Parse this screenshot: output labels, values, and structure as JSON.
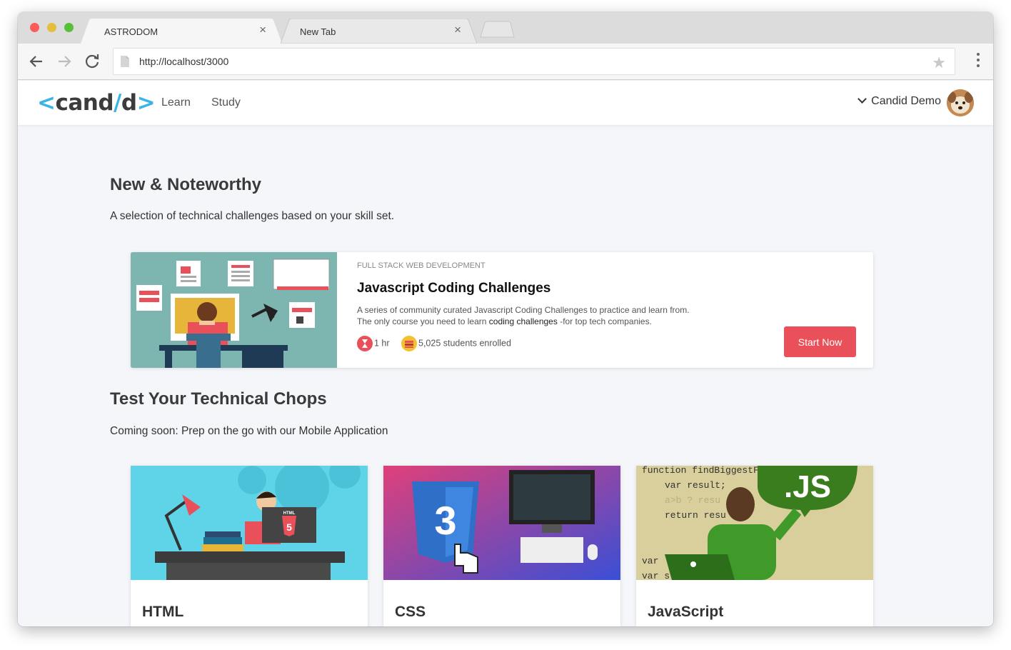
{
  "browser": {
    "tabs": [
      {
        "title": "ASTRODOM",
        "active": true
      },
      {
        "title": "New Tab",
        "active": false
      }
    ],
    "url": "http://localhost/3000"
  },
  "header": {
    "logo": {
      "left": "<",
      "text_a": "cand",
      "slash": "/",
      "text_b": "d",
      "right": ">"
    },
    "nav": [
      "Learn",
      "Study"
    ],
    "user_name": "Candid Demo"
  },
  "section1": {
    "title": "New & Noteworthy",
    "subtitle": "A selection of technical challenges based on your skill set."
  },
  "featured": {
    "category": "FULL STACK WEB DEVELOPMENT",
    "title": "Javascript Coding Challenges",
    "desc_line1": "A series of community curated Javascript Coding Challenges to practice and learn from.",
    "desc_line2_a": "The only course you need to learn ",
    "desc_line2_b": "coding challenges",
    "desc_line2_c": " -for top tech companies.",
    "duration": "1 hr",
    "enrolled": "5,025 students enrolled",
    "cta": "Start Now"
  },
  "section2": {
    "title": "Test Your Technical Chops",
    "subtitle": "Coming soon: Prep on the go with our Mobile Application"
  },
  "courses": [
    {
      "label": "HTML",
      "badge": "HTML",
      "number": "5"
    },
    {
      "label": "CSS",
      "number": "3"
    },
    {
      "label": "JavaScript",
      "badge": ".JS",
      "code": [
        "function findBiggestFr",
        "var result;",
        "a>b ? resu",
        "return resu",
        "var",
        "var s"
      ]
    }
  ],
  "colors": {
    "accent": "#e9505a",
    "brand": "#3ab4e6",
    "page_bg": "#f4f6f9"
  }
}
